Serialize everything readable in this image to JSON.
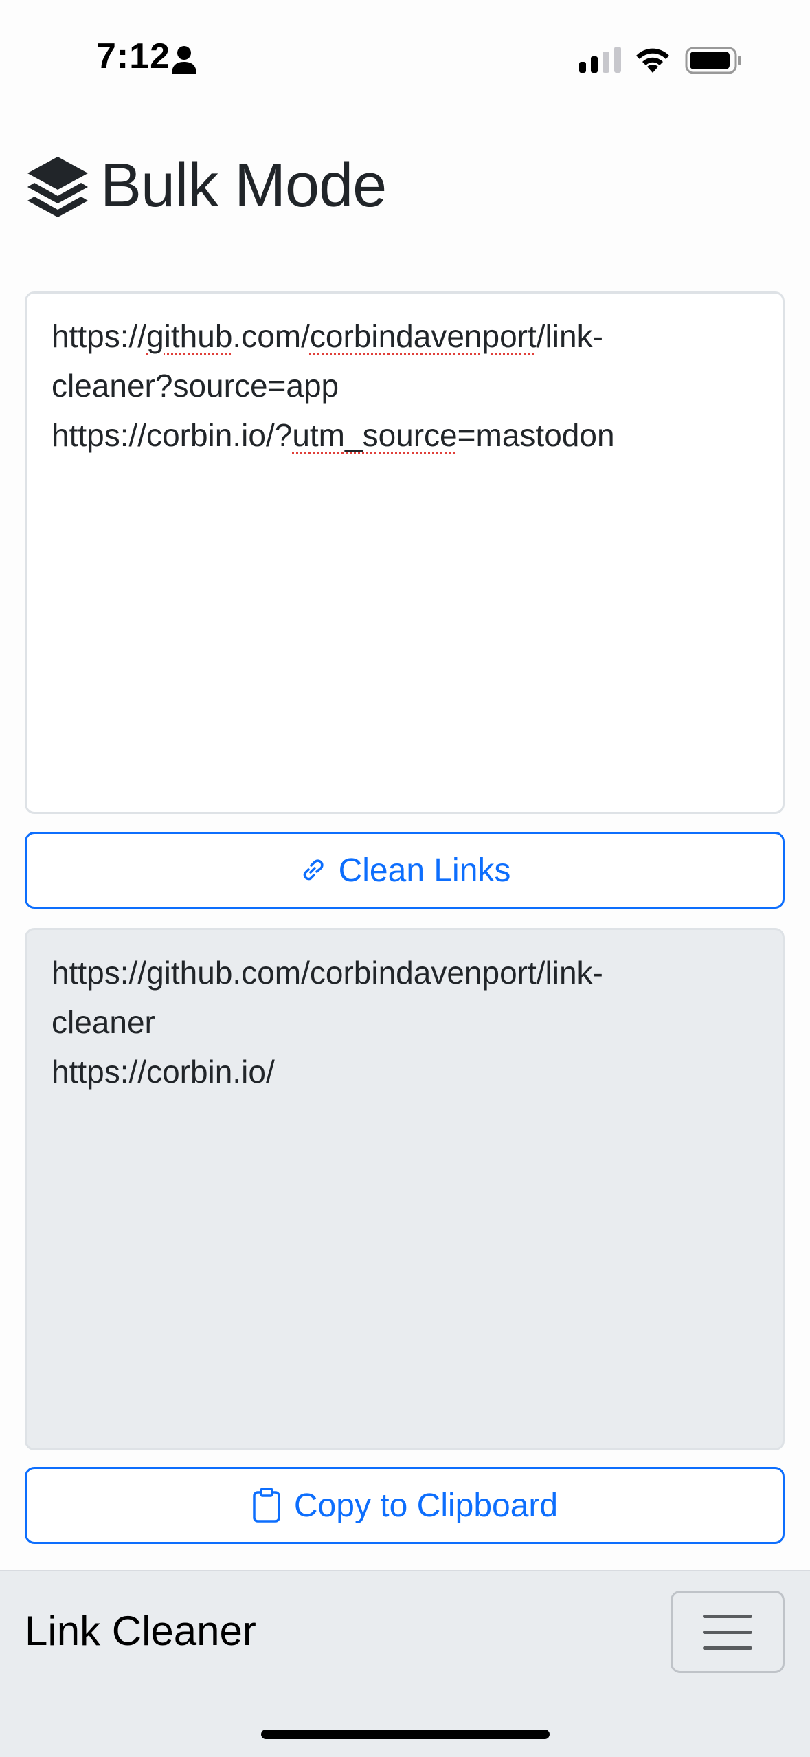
{
  "status_bar": {
    "time": "7:12"
  },
  "header": {
    "title": "Bulk Mode",
    "icon": "layers-icon"
  },
  "input": {
    "lines": [
      {
        "pre": "https://",
        "err": "github",
        "mid": ".com/",
        "err2": "corbindavenport",
        "post": "/link-"
      },
      {
        "text": "cleaner?source=app"
      },
      {
        "pre": "https://corbin.io/?",
        "err": "utm_source",
        "post": "=mastodon"
      }
    ]
  },
  "clean_button": {
    "label": "Clean Links",
    "icon": "link-icon"
  },
  "output": {
    "lines": [
      "https://github.com/corbindavenport/link-",
      "cleaner",
      "https://corbin.io/"
    ]
  },
  "copy_button": {
    "label": "Copy to Clipboard",
    "icon": "clipboard-icon"
  },
  "navbar": {
    "brand": "Link Cleaner",
    "menu_icon": "hamburger-menu-icon"
  },
  "colors": {
    "accent": "#0d6efd",
    "output_bg": "#e9ecef",
    "navbar_bg": "#e9ecef"
  }
}
